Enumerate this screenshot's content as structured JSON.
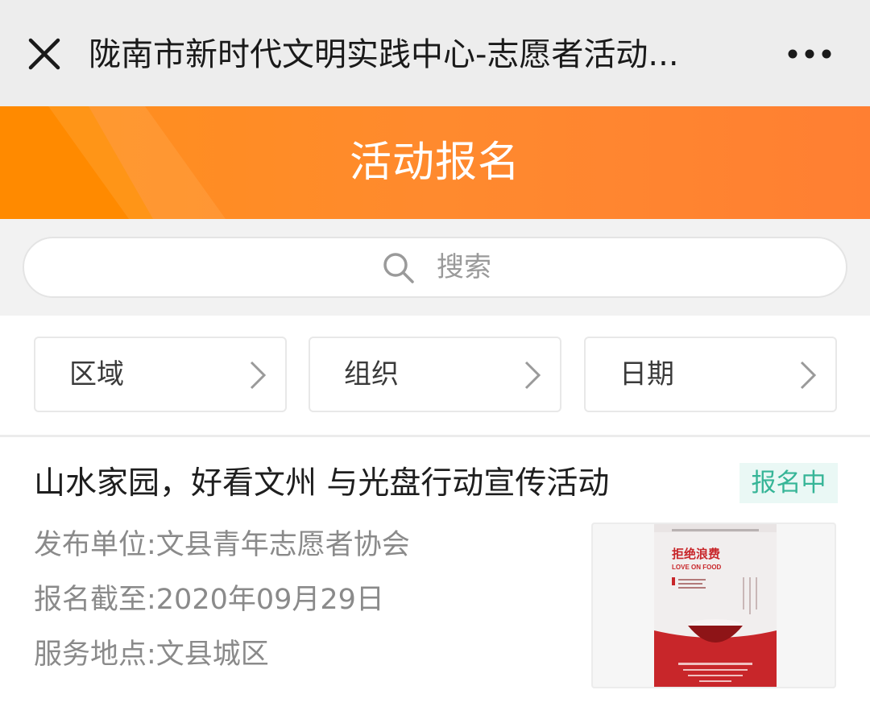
{
  "navbar": {
    "title": "陇南市新时代文明实践中心-志愿者活动...",
    "close_icon": "close-icon",
    "more_icon": "more-icon"
  },
  "banner": {
    "title": "活动报名"
  },
  "search": {
    "placeholder": "搜索",
    "icon": "search-icon"
  },
  "filters": [
    {
      "label": "区域",
      "icon": "chevron-right-icon"
    },
    {
      "label": "组织",
      "icon": "chevron-right-icon"
    },
    {
      "label": "日期",
      "icon": "chevron-right-icon"
    }
  ],
  "activity": {
    "title": "山水家园，好看文州 与光盘行动宣传活动",
    "status": "报名中",
    "publisher": "发布单位:文县青年志愿者协会",
    "deadline": "报名截至:2020年09月29日",
    "location": "服务地点:文县城区",
    "thumbnail": {
      "headline": "拒绝浪费",
      "subline": "LOVE ON FOOD"
    }
  },
  "colors": {
    "banner": "#ff8a2e",
    "status_text": "#36b597",
    "status_bg": "#eaf8f5",
    "poster_red": "#c8262a"
  }
}
